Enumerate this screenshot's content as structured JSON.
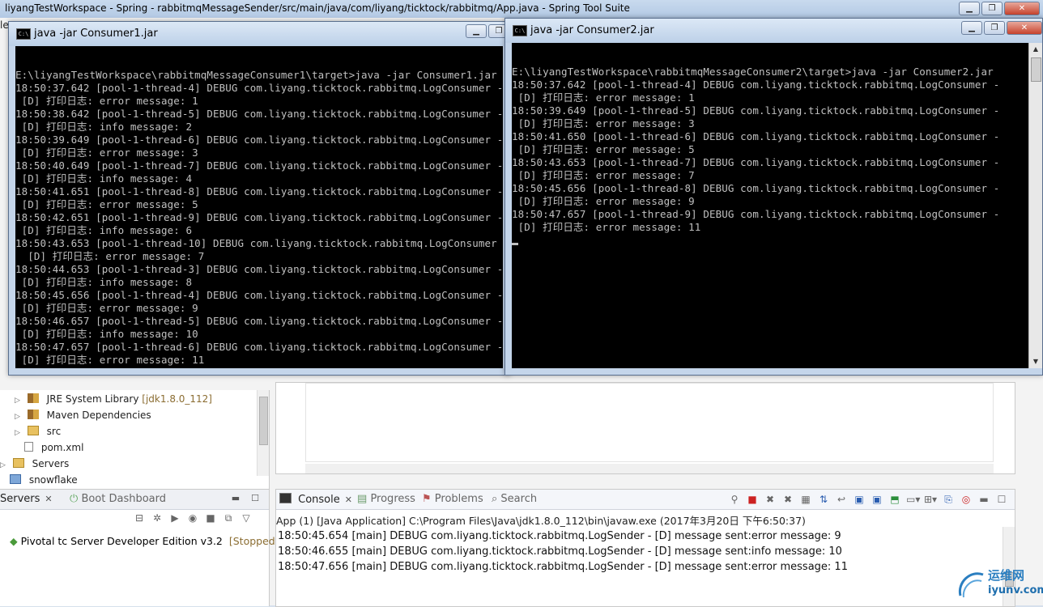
{
  "ide": {
    "title": "liyangTestWorkspace - Spring - rabbitmqMessageSender/src/main/java/com/liyang/ticktock/rabbitmq/App.java - Spring Tool Suite",
    "left_stub": "le"
  },
  "package_explorer": {
    "items": [
      {
        "label": "JRE System Library",
        "suffix": "[jdk1.8.0_112]",
        "icon": "library-icon"
      },
      {
        "label": "Maven Dependencies",
        "suffix": "",
        "icon": "library-icon"
      },
      {
        "label": "src",
        "suffix": "",
        "icon": "folder-icon"
      },
      {
        "label": "pom.xml",
        "suffix": "",
        "icon": "file-icon"
      },
      {
        "label": "Servers",
        "suffix": "",
        "icon": "folder-icon"
      },
      {
        "label": "snowflake",
        "suffix": "",
        "icon": "project-icon"
      }
    ]
  },
  "servers_panel": {
    "tab_servers": "Servers",
    "tab_boot": "Boot Dashboard",
    "server_name": "Pivotal tc Server Developer Edition v3.2",
    "server_status": "[Stopped]"
  },
  "console_panel": {
    "tabs": [
      "Console",
      "Progress",
      "Problems",
      "Search"
    ],
    "info": "App (1) [Java Application] C:\\Program Files\\Java\\jdk1.8.0_112\\bin\\javaw.exe (2017年3月20日 下午6:50:37)",
    "lines": [
      "18:50:45.654 [main] DEBUG com.liyang.ticktock.rabbitmq.LogSender -  [D] message sent:error message: 9",
      "18:50:46.655 [main] DEBUG com.liyang.ticktock.rabbitmq.LogSender -  [D] message sent:info message: 10",
      "18:50:47.656 [main] DEBUG com.liyang.ticktock.rabbitmq.LogSender -  [D] message sent:error message: 11"
    ]
  },
  "consumer1": {
    "title": "java  -jar Consumer1.jar",
    "lines": [
      "",
      "E:\\liyangTestWorkspace\\rabbitmqMessageConsumer1\\target>java -jar Consumer1.jar",
      "18:50:37.642 [pool-1-thread-4] DEBUG com.liyang.ticktock.rabbitmq.LogConsumer -",
      " [D] 打印日志: error message: 1",
      "18:50:38.642 [pool-1-thread-5] DEBUG com.liyang.ticktock.rabbitmq.LogConsumer -",
      " [D] 打印日志: info message: 2",
      "18:50:39.649 [pool-1-thread-6] DEBUG com.liyang.ticktock.rabbitmq.LogConsumer -",
      " [D] 打印日志: error message: 3",
      "18:50:40.649 [pool-1-thread-7] DEBUG com.liyang.ticktock.rabbitmq.LogConsumer -",
      " [D] 打印日志: info message: 4",
      "18:50:41.651 [pool-1-thread-8] DEBUG com.liyang.ticktock.rabbitmq.LogConsumer -",
      " [D] 打印日志: error message: 5",
      "18:50:42.651 [pool-1-thread-9] DEBUG com.liyang.ticktock.rabbitmq.LogConsumer -",
      " [D] 打印日志: info message: 6",
      "18:50:43.653 [pool-1-thread-10] DEBUG com.liyang.ticktock.rabbitmq.LogConsumer",
      "  [D] 打印日志: error message: 7",
      "18:50:44.653 [pool-1-thread-3] DEBUG com.liyang.ticktock.rabbitmq.LogConsumer -",
      " [D] 打印日志: info message: 8",
      "18:50:45.656 [pool-1-thread-4] DEBUG com.liyang.ticktock.rabbitmq.LogConsumer -",
      " [D] 打印日志: error message: 9",
      "18:50:46.657 [pool-1-thread-5] DEBUG com.liyang.ticktock.rabbitmq.LogConsumer -",
      " [D] 打印日志: info message: 10",
      "18:50:47.657 [pool-1-thread-6] DEBUG com.liyang.ticktock.rabbitmq.LogConsumer -",
      " [D] 打印日志: error message: 11"
    ]
  },
  "consumer2": {
    "title": "java  -jar Consumer2.jar",
    "lines": [
      "",
      "E:\\liyangTestWorkspace\\rabbitmqMessageConsumer2\\target>java -jar Consumer2.jar",
      "18:50:37.642 [pool-1-thread-4] DEBUG com.liyang.ticktock.rabbitmq.LogConsumer -",
      " [D] 打印日志: error message: 1",
      "18:50:39.649 [pool-1-thread-5] DEBUG com.liyang.ticktock.rabbitmq.LogConsumer -",
      " [D] 打印日志: error message: 3",
      "18:50:41.650 [pool-1-thread-6] DEBUG com.liyang.ticktock.rabbitmq.LogConsumer -",
      " [D] 打印日志: error message: 5",
      "18:50:43.653 [pool-1-thread-7] DEBUG com.liyang.ticktock.rabbitmq.LogConsumer -",
      " [D] 打印日志: error message: 7",
      "18:50:45.656 [pool-1-thread-8] DEBUG com.liyang.ticktock.rabbitmq.LogConsumer -",
      " [D] 打印日志: error message: 9",
      "18:50:47.657 [pool-1-thread-9] DEBUG com.liyang.ticktock.rabbitmq.LogConsumer -",
      " [D] 打印日志: error message: 11"
    ]
  },
  "watermark": {
    "line1": "运维网",
    "line2": "iyunv.com"
  }
}
